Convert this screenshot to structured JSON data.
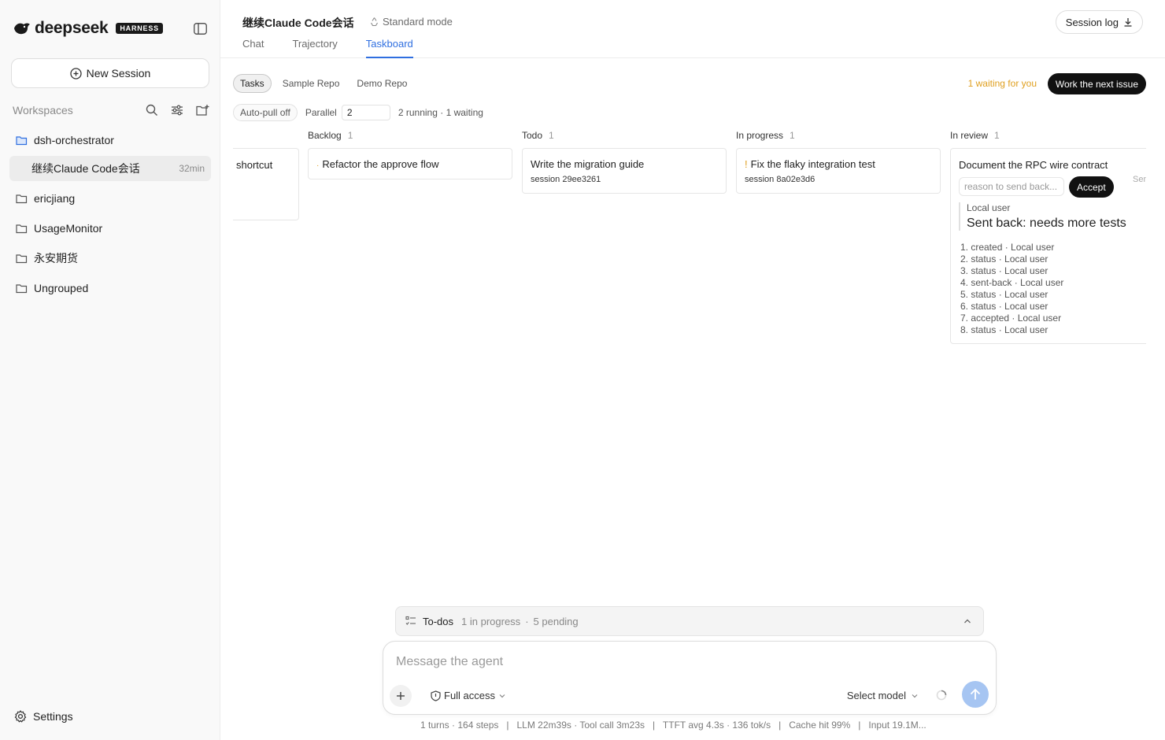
{
  "sidebar": {
    "brand": "deepseek",
    "brand_badge": "HARNESS",
    "new_session_label": "New Session",
    "workspaces_title": "Workspaces",
    "workspaces": [
      {
        "label": "dsh-orchestrator",
        "open": true
      },
      {
        "label": "ericjiang"
      },
      {
        "label": "UsageMonitor"
      },
      {
        "label": "永安期货"
      },
      {
        "label": "Ungrouped"
      }
    ],
    "active_session": {
      "label": "继续Claude Code会话",
      "time": "32min"
    },
    "settings_label": "Settings"
  },
  "header": {
    "title": "继续Claude Code会话",
    "mode": "Standard mode",
    "tabs": [
      "Chat",
      "Trajectory",
      "Taskboard"
    ],
    "active_tab": "Taskboard",
    "session_log_label": "Session log"
  },
  "board": {
    "repo_tabs": [
      "Tasks",
      "Sample Repo",
      "Demo Repo"
    ],
    "waiting_text": "1 waiting for you",
    "work_next_label": "Work the next issue",
    "auto_pull": "Auto-pull off",
    "parallel_label": "Parallel",
    "parallel_value": "2",
    "status_text": "2 running · 1 waiting",
    "columns": [
      {
        "name": "Backlog",
        "count": "1",
        "cards": [
          {
            "title": "Refactor the approve flow",
            "marker": "·"
          }
        ]
      },
      {
        "name": "Todo",
        "count": "1",
        "cards": [
          {
            "title": "Write the migration guide",
            "session": "session 29ee3261"
          }
        ]
      },
      {
        "name": "In progress",
        "count": "1",
        "cards": [
          {
            "title": "Fix the flaky integration test",
            "marker": "!",
            "session": "session 8a02e3d6"
          }
        ]
      },
      {
        "name": "In review",
        "count": "1",
        "cards": [
          {
            "title": "Document the RPC wire contract",
            "reason_placeholder": "reason to send back...",
            "accept_label": "Accept",
            "send_back_label": "Send back",
            "quote_author": "Local user",
            "quote_text": "Sent back: needs more tests",
            "history": [
              "1. created · Local user",
              "2. status · Local user",
              "3. status · Local user",
              "4. sent-back · Local user",
              "5. status · Local user",
              "6. status · Local user",
              "7. accepted · Local user",
              "8. status · Local user"
            ]
          }
        ]
      }
    ],
    "partial_card_title": "shortcut"
  },
  "todos": {
    "label": "To-dos",
    "in_progress": "1 in progress",
    "pending": "5 pending"
  },
  "composer": {
    "placeholder": "Message the agent",
    "access_label": "Full access",
    "model_label": "Select model"
  },
  "stats": "1 turns · 164 steps   |   LLM 22m39s · Tool call 3m23s   |   TTFT avg 4.3s · 136 tok/s   |   Cache hit 99%   |   Input 19.1M...",
  "colors": {
    "accent": "#2f6fe0",
    "waiting": "#e0a020",
    "dark_button": "#111111",
    "send_button": "#a6c5f2"
  }
}
